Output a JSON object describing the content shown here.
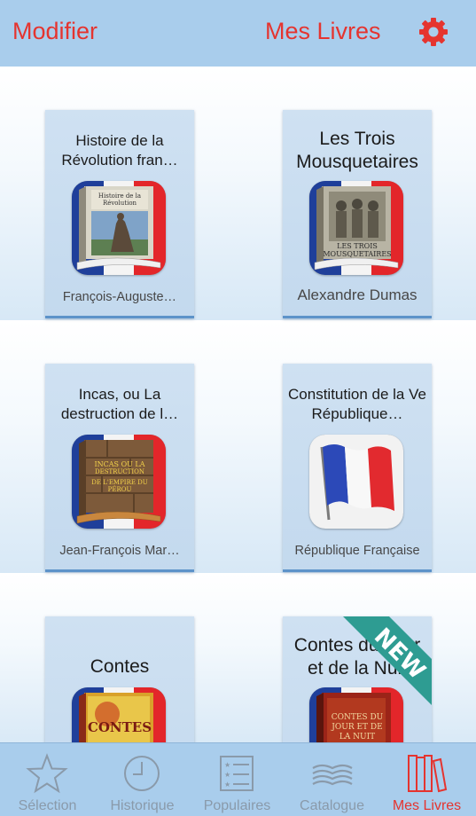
{
  "navbar": {
    "edit_label": "Modifier",
    "title": "Mes Livres",
    "gear_icon": "gear-icon"
  },
  "books": [
    {
      "title": "Histoire de la Révolution fran…",
      "author": "François-Auguste…",
      "cover_icon": "statue-book-cover"
    },
    {
      "title": "Les Trois Mousquetaires",
      "author": "Alexandre Dumas",
      "cover_icon": "musketeers-book-cover"
    },
    {
      "title": "Incas, ou La destruction de l…",
      "author": "Jean-François Mar…",
      "cover_icon": "incas-book-cover"
    },
    {
      "title": "Constitution de la Ve République…",
      "author": "République Française",
      "cover_icon": "french-flag-cover"
    },
    {
      "title": "Contes",
      "author": "",
      "cover_icon": "contes-book-cover",
      "cover_text": "CONTES"
    },
    {
      "title": "Contes du Jour et de la Nuit",
      "author": "",
      "cover_icon": "contes-jour-book-cover",
      "badge": "NEW",
      "cover_text": "CONTES DU JOUR ET DE LA NUIT"
    }
  ],
  "colors": {
    "accent": "#e5342f",
    "bar": "#a9cdec",
    "inactive": "#8a9aaa"
  },
  "tabs": [
    {
      "label": "Sélection",
      "icon": "star-icon",
      "active": false
    },
    {
      "label": "Historique",
      "icon": "clock-icon",
      "active": false
    },
    {
      "label": "Populaires",
      "icon": "list-icon",
      "active": false
    },
    {
      "label": "Catalogue",
      "icon": "open-book-icon",
      "active": false
    },
    {
      "label": "Mes Livres",
      "icon": "books-icon",
      "active": true
    }
  ]
}
